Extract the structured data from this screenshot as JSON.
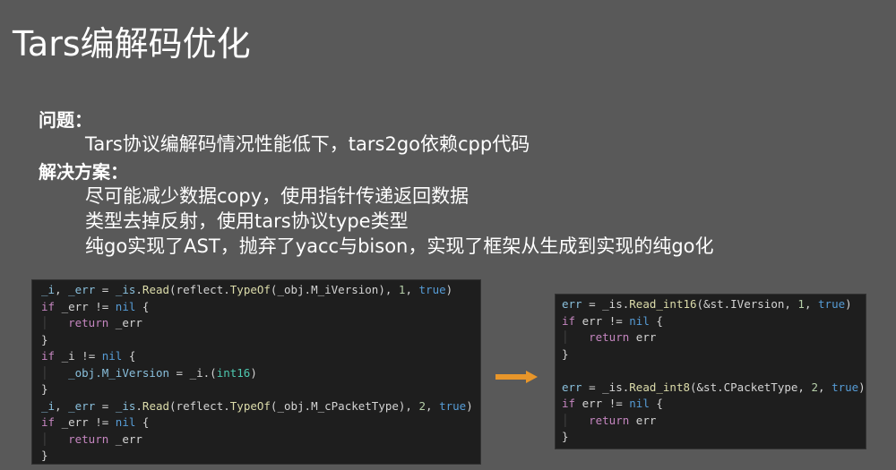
{
  "title": "Tars编解码优化",
  "problem": {
    "heading": "问题：",
    "text": "Tars协议编解码情况性能低下，tars2go依赖cpp代码"
  },
  "solution": {
    "heading": "解决方案：",
    "items": [
      "尽可能减少数据copy，使用指针传递返回数据",
      "类型去掉反射，使用tars协议type类型",
      "纯go实现了AST，抛弃了yacc与bison，实现了框架从生成到实现的纯go化"
    ]
  },
  "arrow_color": "#e8962a",
  "code_before": [
    [
      [
        "var",
        "_i"
      ],
      [
        "plain",
        ", "
      ],
      [
        "var",
        "_err"
      ],
      [
        "plain",
        " = "
      ],
      [
        "var",
        "_is"
      ],
      [
        "plain",
        "."
      ],
      [
        "fn",
        "Read"
      ],
      [
        "plain",
        "(reflect."
      ],
      [
        "fn",
        "TypeOf"
      ],
      [
        "plain",
        "(_obj.M_iVersion), "
      ],
      [
        "num",
        "1"
      ],
      [
        "plain",
        ", "
      ],
      [
        "const",
        "true"
      ],
      [
        "plain",
        ")"
      ]
    ],
    [
      [
        "kw",
        "if"
      ],
      [
        "plain",
        " _err != "
      ],
      [
        "const",
        "nil"
      ],
      [
        "plain",
        " {"
      ]
    ],
    [
      [
        "guard",
        "│   "
      ],
      [
        "kw",
        "return"
      ],
      [
        "plain",
        " _err"
      ]
    ],
    [
      [
        "plain",
        "}"
      ]
    ],
    [
      [
        "kw",
        "if"
      ],
      [
        "plain",
        " _i != "
      ],
      [
        "const",
        "nil"
      ],
      [
        "plain",
        " {"
      ]
    ],
    [
      [
        "guard",
        "│   "
      ],
      [
        "var",
        "_obj.M_iVersion"
      ],
      [
        "plain",
        " = _i.("
      ],
      [
        "type",
        "int16"
      ],
      [
        "plain",
        ")"
      ]
    ],
    [
      [
        "plain",
        "}"
      ]
    ],
    [
      [
        "var",
        "_i"
      ],
      [
        "plain",
        ", "
      ],
      [
        "var",
        "_err"
      ],
      [
        "plain",
        " = "
      ],
      [
        "var",
        "_is"
      ],
      [
        "plain",
        "."
      ],
      [
        "fn",
        "Read"
      ],
      [
        "plain",
        "(reflect."
      ],
      [
        "fn",
        "TypeOf"
      ],
      [
        "plain",
        "(_obj.M_cPacketType), "
      ],
      [
        "num",
        "2"
      ],
      [
        "plain",
        ", "
      ],
      [
        "const",
        "true"
      ],
      [
        "plain",
        ")"
      ]
    ],
    [
      [
        "kw",
        "if"
      ],
      [
        "plain",
        " _err != "
      ],
      [
        "const",
        "nil"
      ],
      [
        "plain",
        " {"
      ]
    ],
    [
      [
        "guard",
        "│   "
      ],
      [
        "kw",
        "return"
      ],
      [
        "plain",
        " _err"
      ]
    ],
    [
      [
        "plain",
        "}"
      ]
    ]
  ],
  "code_after": [
    [
      [
        "var",
        "err"
      ],
      [
        "plain",
        " = _is."
      ],
      [
        "fn",
        "Read_int16"
      ],
      [
        "plain",
        "(&st.IVersion, "
      ],
      [
        "num",
        "1"
      ],
      [
        "plain",
        ", "
      ],
      [
        "const",
        "true"
      ],
      [
        "plain",
        ")"
      ]
    ],
    [
      [
        "kw",
        "if"
      ],
      [
        "plain",
        " err != "
      ],
      [
        "const",
        "nil"
      ],
      [
        "plain",
        " {"
      ]
    ],
    [
      [
        "guard",
        "│   "
      ],
      [
        "kw",
        "return"
      ],
      [
        "plain",
        " err"
      ]
    ],
    [
      [
        "plain",
        "}"
      ]
    ],
    [
      [
        "plain",
        " "
      ]
    ],
    [
      [
        "var",
        "err"
      ],
      [
        "plain",
        " = _is."
      ],
      [
        "fn",
        "Read_int8"
      ],
      [
        "plain",
        "(&st.CPacketType, "
      ],
      [
        "num",
        "2"
      ],
      [
        "plain",
        ", "
      ],
      [
        "const",
        "true"
      ],
      [
        "plain",
        ")"
      ]
    ],
    [
      [
        "kw",
        "if"
      ],
      [
        "plain",
        " err != "
      ],
      [
        "const",
        "nil"
      ],
      [
        "plain",
        " {"
      ]
    ],
    [
      [
        "guard",
        "│   "
      ],
      [
        "kw",
        "return"
      ],
      [
        "plain",
        " err"
      ]
    ],
    [
      [
        "plain",
        "}"
      ]
    ]
  ]
}
